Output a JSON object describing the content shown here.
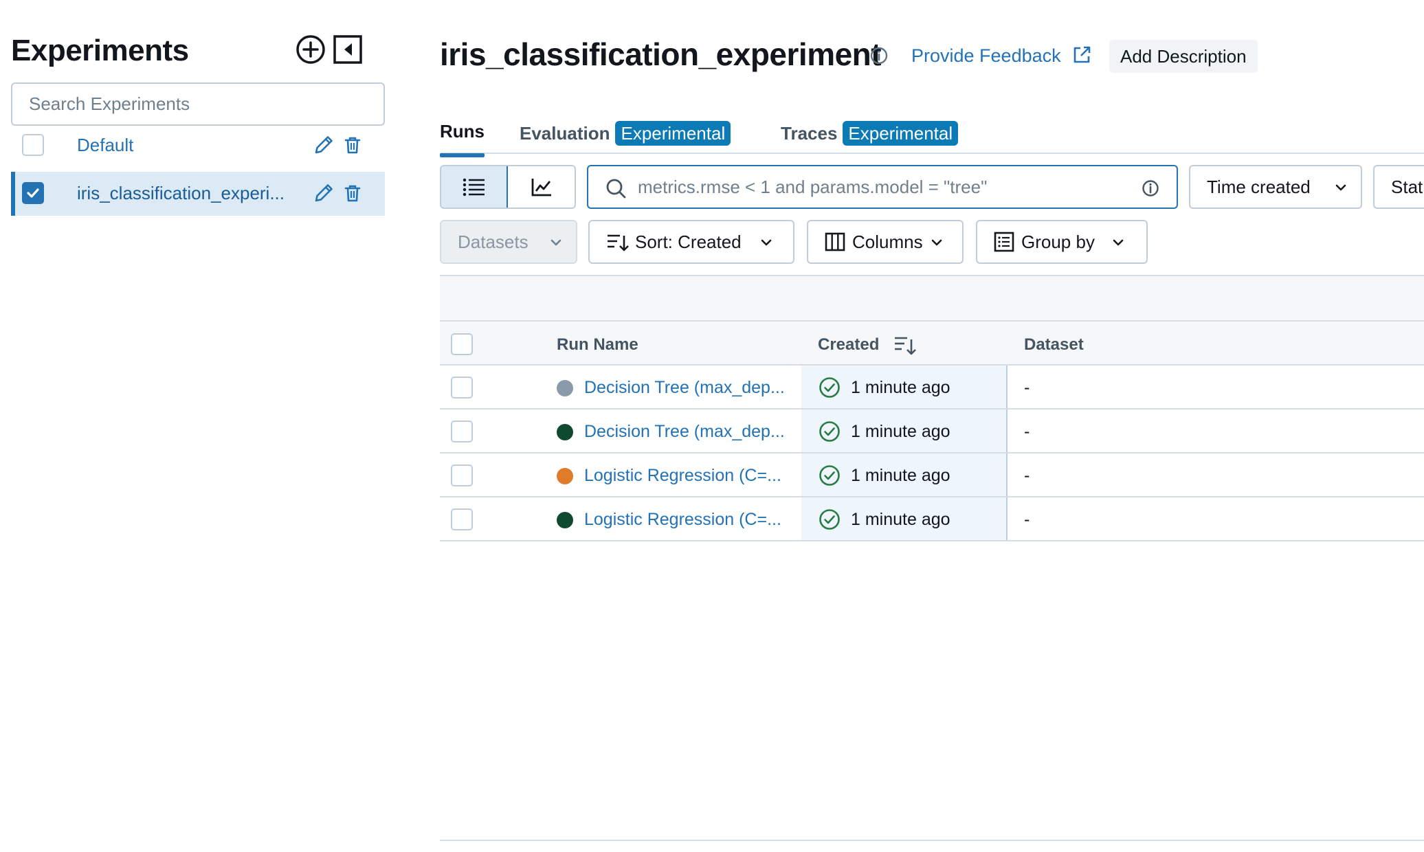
{
  "sidebar": {
    "title": "Experiments",
    "search_placeholder": "Search Experiments",
    "items": [
      {
        "name": "Default",
        "checked": false
      },
      {
        "name": "iris_classification_experi...",
        "checked": true
      }
    ]
  },
  "header": {
    "title": "iris_classification_experiment",
    "feedback_label": "Provide Feedback",
    "add_description_label": "Add Description"
  },
  "tabs": [
    {
      "label": "Runs",
      "badge": ""
    },
    {
      "label": "Evaluation",
      "badge": "Experimental"
    },
    {
      "label": "Traces",
      "badge": "Experimental"
    }
  ],
  "toolbar": {
    "search_placeholder": "metrics.rmse < 1 and params.model = \"tree\"",
    "time_filter_label": "Time created",
    "status_filter_label": "Stat",
    "datasets_label": "Datasets",
    "sort_label": "Sort: Created",
    "columns_label": "Columns",
    "group_by_label": "Group by"
  },
  "table": {
    "columns": [
      "Run Name",
      "Created",
      "Dataset"
    ],
    "rows": [
      {
        "run_name": "Decision Tree (max_dep...",
        "created": "1 minute ago",
        "dataset": "-",
        "color": "#8a9aa8"
      },
      {
        "run_name": "Decision Tree (max_dep...",
        "created": "1 minute ago",
        "dataset": "-",
        "color": "#0f4a2e"
      },
      {
        "run_name": "Logistic Regression (C=...",
        "created": "1 minute ago",
        "dataset": "-",
        "color": "#e07b2a"
      },
      {
        "run_name": "Logistic Regression (C=...",
        "created": "1 minute ago",
        "dataset": "-",
        "color": "#0f4a2e"
      }
    ]
  },
  "colors": {
    "accent": "#2272b4",
    "badge": "#0c7ab5",
    "success": "#277c43"
  }
}
